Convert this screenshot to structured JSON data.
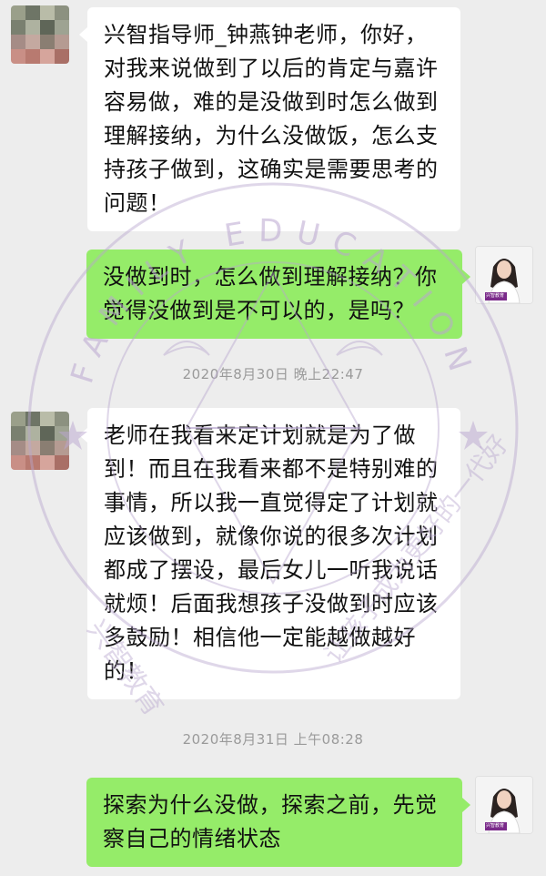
{
  "messages": [
    {
      "text": "兴智指导师_钟燕钟老师，你好，对我来说做到了以后的肯定与嘉许容易做，难的是没做到时怎么做到理解接纳，为什么没做饭，怎么支持孩子做到，这确实是需要思考的问题！"
    },
    {
      "text": "没做到时，怎么做到理解接纳？你觉得没做到是不可以的，是吗？"
    },
    {
      "text": "老师在我看来定计划就是为了做到！而且在我看来都不是特别难的事情，所以我一直觉得定了计划就应该做到，就像你说的很多次计划都成了摆设，最后女儿一听我说话就烦！后面我想孩子没做到时应该多鼓励！相信他一定能越做越好的！"
    },
    {
      "text": "探索为什么没做，探索之前，先觉察自己的情绪状态"
    }
  ],
  "timestamps": [
    "2020年8月30日 晚上22:47",
    "2020年8月31日 上午08:28"
  ],
  "avatar_badge": "兴智教育",
  "watermark": {
    "arc_text": "FAMILY EDUCATION",
    "side_left": "兴智教育",
    "side_right": "让孩子成为更好的一代好"
  },
  "colors": {
    "background": "#ededed",
    "incoming_bubble": "#ffffff",
    "outgoing_bubble": "#95ec69",
    "timestamp": "#9a9a9a"
  }
}
